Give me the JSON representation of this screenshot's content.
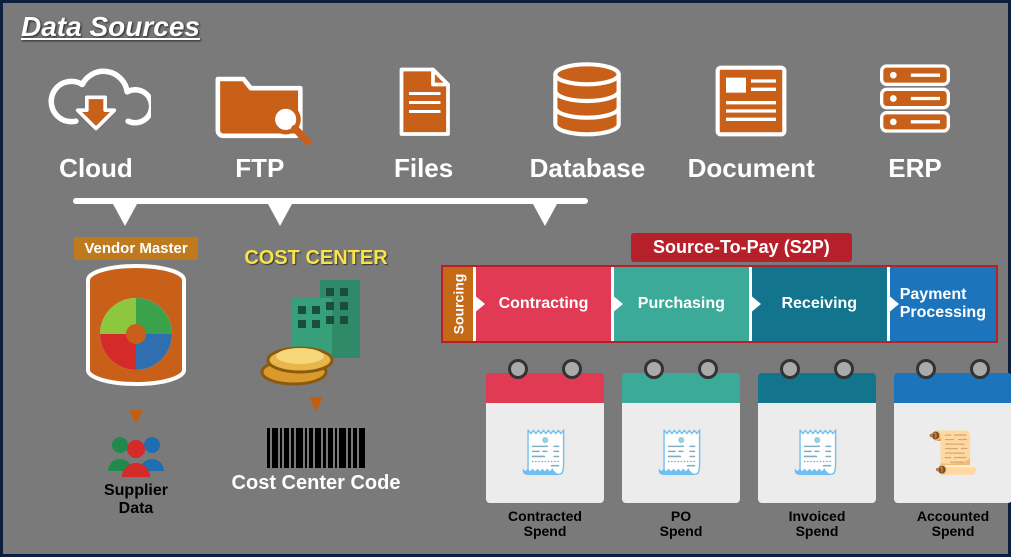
{
  "title": "Data Sources",
  "sources": [
    {
      "id": "cloud",
      "label": "Cloud"
    },
    {
      "id": "ftp",
      "label": "FTP"
    },
    {
      "id": "files",
      "label": "Files"
    },
    {
      "id": "database",
      "label": "Database"
    },
    {
      "id": "document",
      "label": "Document"
    },
    {
      "id": "erp",
      "label": "ERP"
    }
  ],
  "vendor": {
    "title": "Vendor Master",
    "subtext": "Supplier\nData"
  },
  "costcenter": {
    "title": "COST CENTER",
    "label": "Cost Center Code"
  },
  "s2p": {
    "header": "Source-To-Pay (S2P)",
    "sourcing": "Sourcing",
    "steps": [
      {
        "id": "contracting",
        "label": "Contracting",
        "color": "#e03a54"
      },
      {
        "id": "purchasing",
        "label": "Purchasing",
        "color": "#3caa99"
      },
      {
        "id": "receiving",
        "label": "Receiving",
        "color": "#13748e"
      },
      {
        "id": "payment",
        "label": "Payment Processing",
        "color": "#1c75bc"
      }
    ],
    "spend": [
      {
        "id": "contracted",
        "label": "Contracted\nSpend",
        "hdr": "red"
      },
      {
        "id": "po",
        "label": "PO\nSpend",
        "hdr": "teal"
      },
      {
        "id": "invoiced",
        "label": "Invoiced\nSpend",
        "hdr": "dteal"
      },
      {
        "id": "accounted",
        "label": "Accounted\nSpend",
        "hdr": "blue"
      }
    ]
  }
}
